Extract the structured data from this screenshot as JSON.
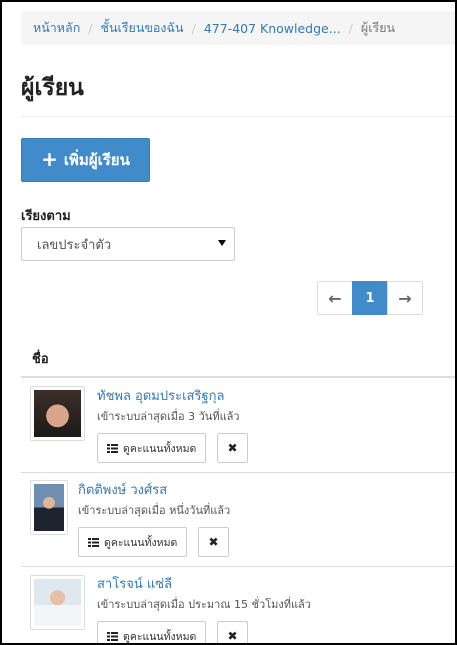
{
  "breadcrumb": {
    "items": [
      "หน้าหลัก",
      "ชั้นเรียนของฉัน",
      "477-407 Knowledge..."
    ],
    "current": "ผู้เรียน",
    "separator": "/"
  },
  "page_title": "ผู้เรียน",
  "add_button": {
    "icon": "plus-icon",
    "label": "เพิ่มผู้เรียน"
  },
  "sort": {
    "label": "เรียงตาม",
    "selected": "เลขประจำตัว"
  },
  "pagination": {
    "prev": "←",
    "current": "1",
    "next": "→"
  },
  "table": {
    "header": "ชื่อ",
    "rows": [
      {
        "name": "ทัชพล อุดมประเสริฐกุล",
        "last_seen": "เข้าระบบล่าสุดเมื่อ 3 วันที่แล้ว",
        "view_label": "ดูคะแนนทั้งหมด",
        "remove_label": "✖"
      },
      {
        "name": "กิตติพงษ์ วงศ์รส",
        "last_seen": "เข้าระบบล่าสุดเมื่อ หนึ่งวันที่แล้ว",
        "view_label": "ดูคะแนนทั้งหมด",
        "remove_label": "✖"
      },
      {
        "name": "สาโรจน์ แซ่ลี",
        "last_seen": "เข้าระบบล่าสุดเมื่อ ประมาณ 15 ชั่วโมงที่แล้ว",
        "view_label": "ดูคะแนนทั้งหมด",
        "remove_label": "✖"
      }
    ]
  },
  "colors": {
    "link": "#337ab7",
    "primary": "#428bca",
    "breadcrumb_bg": "#f5f5f5"
  }
}
